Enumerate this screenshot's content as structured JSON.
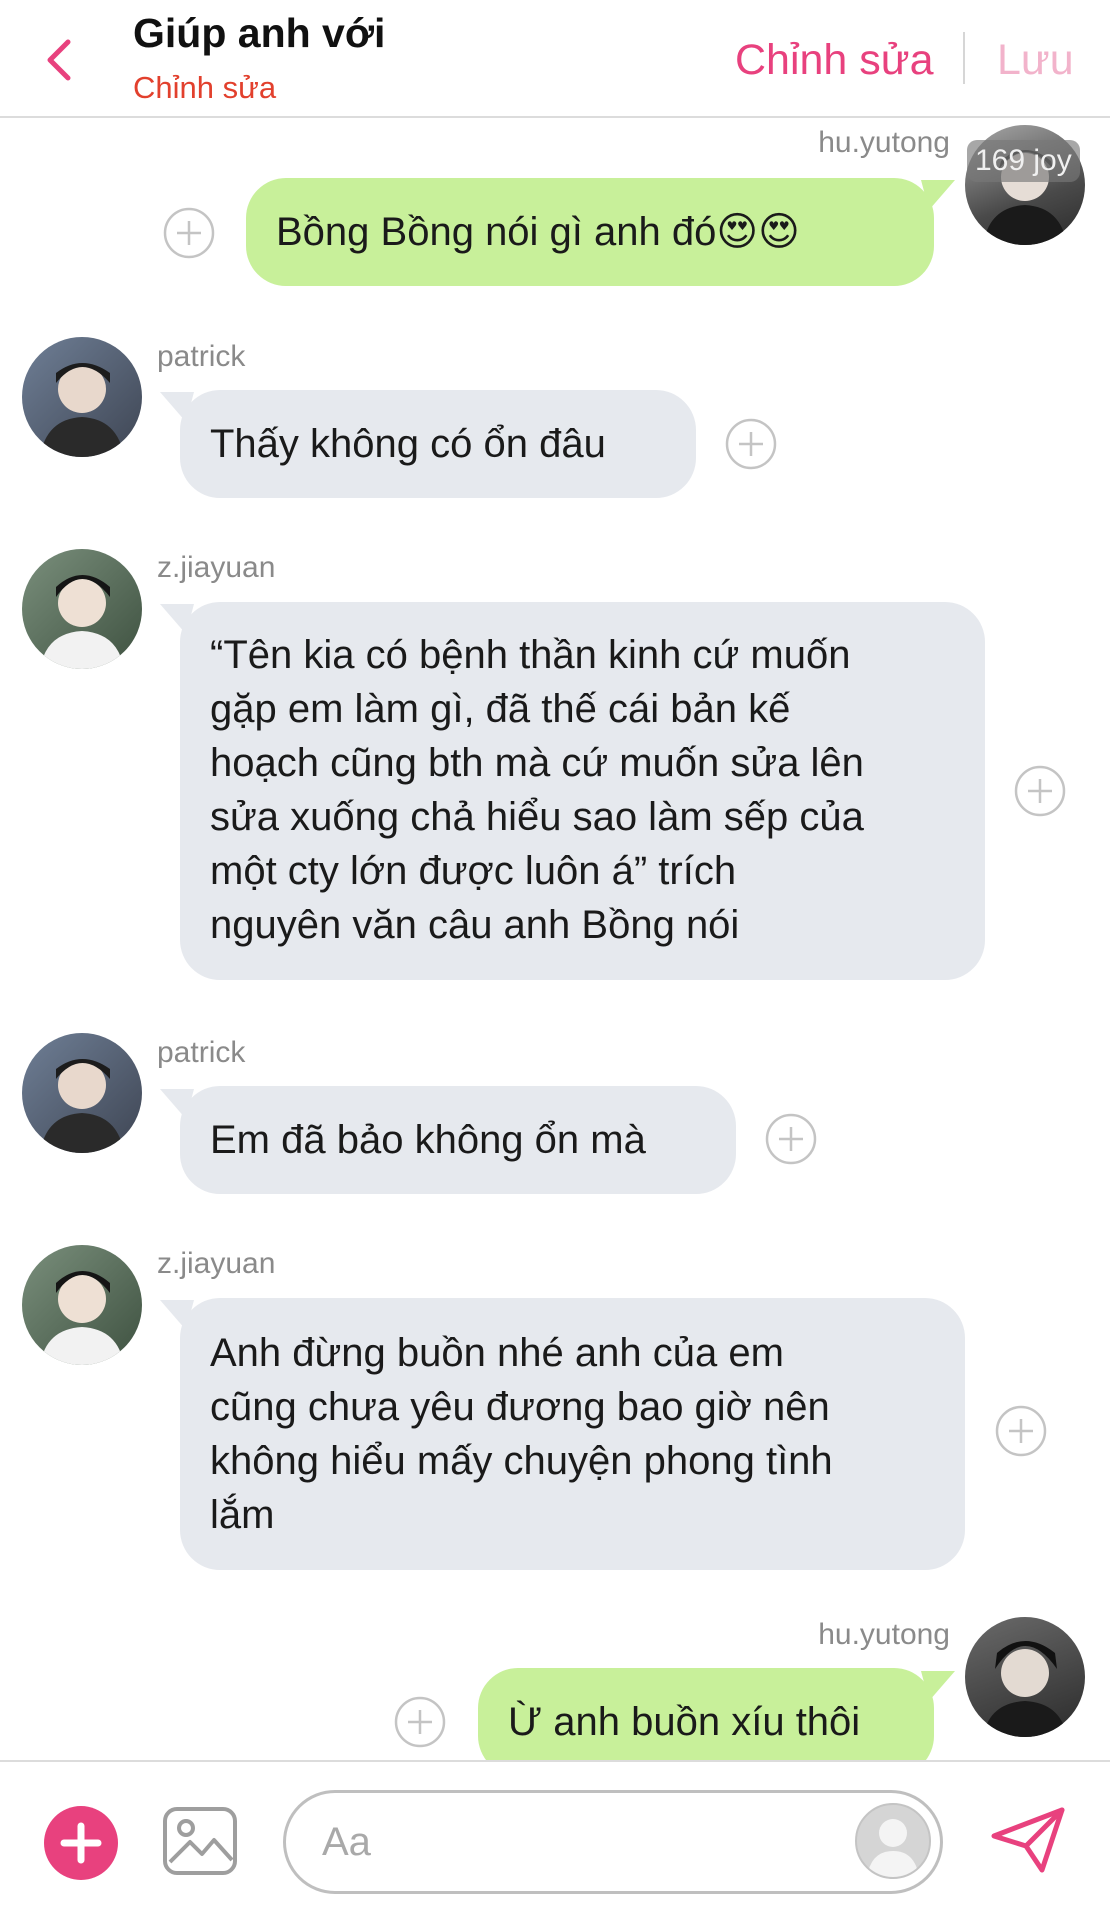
{
  "header": {
    "title": "Giúp anh với",
    "subtitle": "Chỉnh sửa",
    "edit_label": "Chỉnh sửa",
    "save_label": "Lưu"
  },
  "messages": [
    {
      "sender": "hu.yutong",
      "side": "right",
      "text": "Bồng Bồng nói gì anh đó😍😍",
      "avatar_badge": "169 joy"
    },
    {
      "sender": "patrick",
      "side": "left",
      "text": "Thấy không có ổn đâu"
    },
    {
      "sender": "z.jiayuan",
      "side": "left",
      "lines": [
        "“Tên kia có bệnh thần kinh cứ muốn",
        "gặp em làm gì, đã thế cái bản kế",
        "hoạch cũng bth mà cứ muốn sửa lên",
        "sửa xuống chả hiểu sao làm sếp của",
        "một cty lớn được luôn á” trích",
        "nguyên văn câu anh Bồng nói"
      ]
    },
    {
      "sender": "patrick",
      "side": "left",
      "text": "Em đã bảo không ổn mà"
    },
    {
      "sender": "z.jiayuan",
      "side": "left",
      "lines": [
        "Anh đừng buồn nhé anh của em",
        "cũng chưa yêu đương bao giờ nên",
        "không hiểu mấy chuyện phong tình",
        "lắm"
      ]
    },
    {
      "sender": "hu.yutong",
      "side": "right",
      "text": "Ừ anh buồn xíu thôi"
    }
  ],
  "composer": {
    "placeholder": "Aa"
  },
  "colors": {
    "accent": "#e8417e",
    "subtitle": "#e2402d",
    "outgoing_bubble": "#c8f09a",
    "incoming_bubble": "#e6e9ee"
  }
}
